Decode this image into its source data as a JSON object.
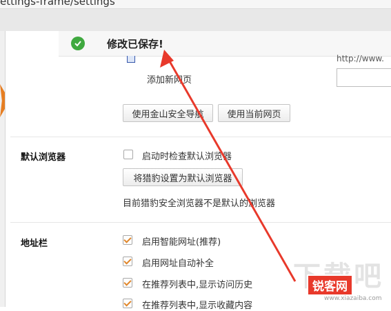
{
  "window": {
    "url_fragment": "ettings-frame/settings"
  },
  "banner": {
    "message": "修改已保存!"
  },
  "startup": {
    "partial_url": "http://www.",
    "new_page_label": "添加新网页",
    "use_duba_nav_button": "使用金山安全导航",
    "use_current_page_button": "使用当前网页"
  },
  "default_browser": {
    "section_title": "默认浏览器",
    "check_on_start_label": "启动时检查默认浏览器",
    "check_on_start_checked": false,
    "set_default_button": "将猎豹设置为默认浏览器",
    "status_text": "目前猎豹安全浏览器不是默认的浏览器"
  },
  "address_bar": {
    "section_title": "地址栏",
    "options": [
      {
        "label": "启用智能网址(推荐)",
        "checked": true
      },
      {
        "label": "启用网址自动补全",
        "checked": true
      },
      {
        "label": "在推荐列表中,显示访问历史",
        "checked": true
      },
      {
        "label": "在推荐列表中,显示收藏内容",
        "checked": true
      }
    ]
  },
  "watermark": {
    "brand": "锐客网",
    "url": "www.xiazaiba.com",
    "big_text": "下载吧"
  },
  "colors": {
    "check_green": "#3fa93f",
    "checkbox_orange": "#e0862a",
    "arrow_red": "#e8392b"
  }
}
